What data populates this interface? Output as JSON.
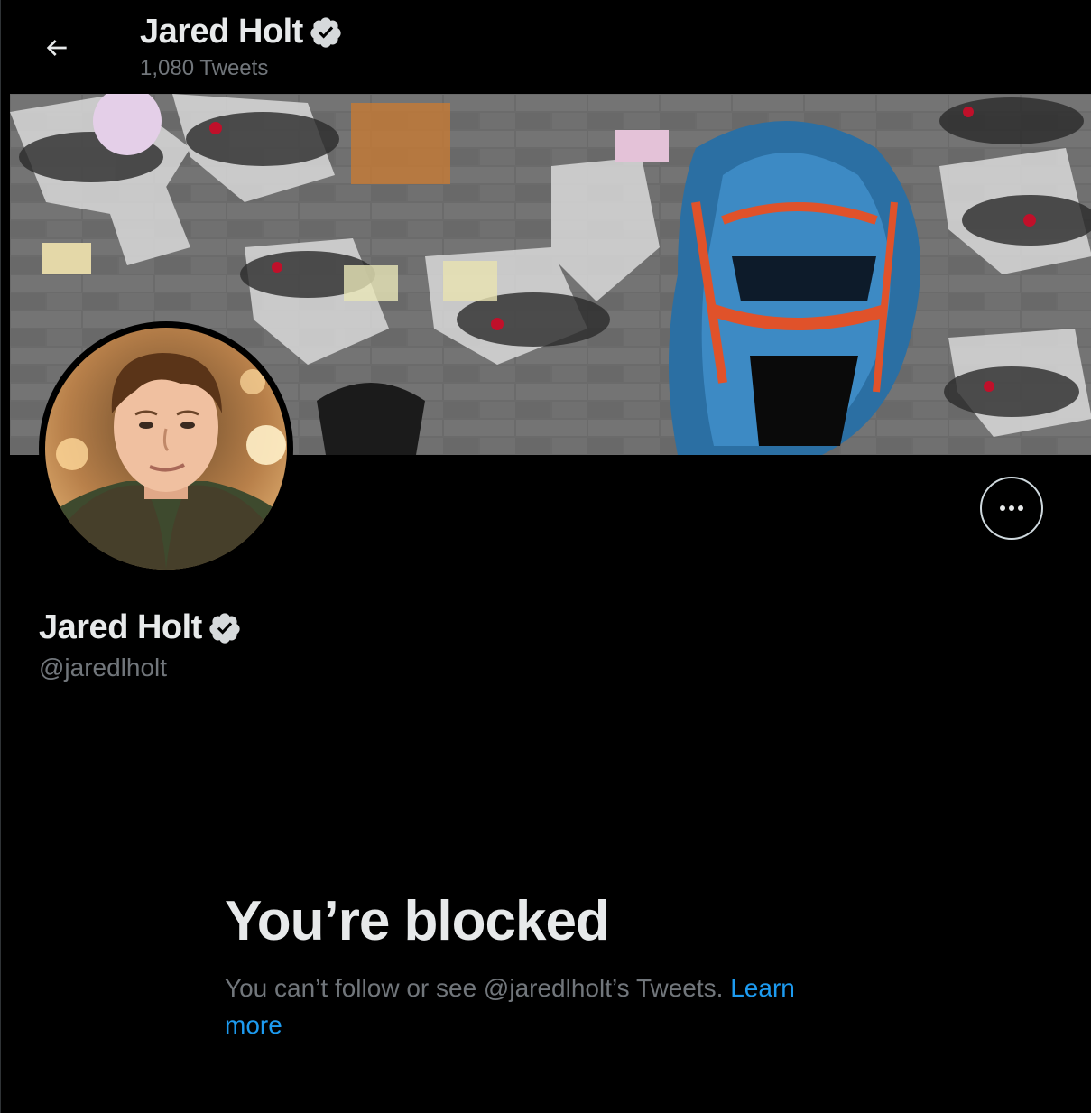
{
  "header": {
    "name": "Jared Holt",
    "tweet_count": "1,080 Tweets"
  },
  "profile": {
    "name": "Jared Holt",
    "handle": "@jaredlholt",
    "verified": true
  },
  "blocked": {
    "title": "You’re blocked",
    "message": "You can’t follow or see @jaredlholt’s Tweets.",
    "link_label": "Learn more"
  },
  "icons": {
    "back": "arrow-left-icon",
    "verified": "verified-badge-icon",
    "more": "more-horizontal-icon"
  },
  "colors": {
    "background": "#000000",
    "text_primary": "#e7e9ea",
    "text_secondary": "#71767b",
    "link": "#1d9bf0"
  }
}
